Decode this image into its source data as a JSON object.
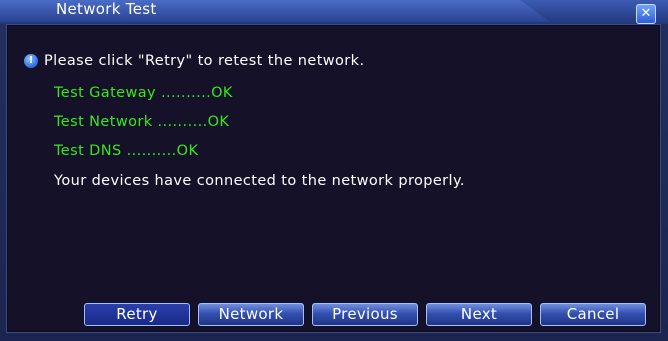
{
  "window": {
    "title": "Network Test",
    "close_icon": "close-icon"
  },
  "message": {
    "icon": "info-icon",
    "text": "Please click \"Retry\" to retest the network."
  },
  "results": [
    {
      "label": "Test Gateway ..........OK"
    },
    {
      "label": "Test Network ..........OK"
    },
    {
      "label": "Test DNS ..........OK"
    }
  ],
  "summary": "Your devices have connected to the network properly.",
  "buttons": {
    "retry": "Retry",
    "network": "Network",
    "previous": "Previous",
    "next": "Next",
    "cancel": "Cancel"
  },
  "colors": {
    "result_text": "#39e81b",
    "title_bar": "#3d5bb4",
    "content_bg": "#141129"
  }
}
